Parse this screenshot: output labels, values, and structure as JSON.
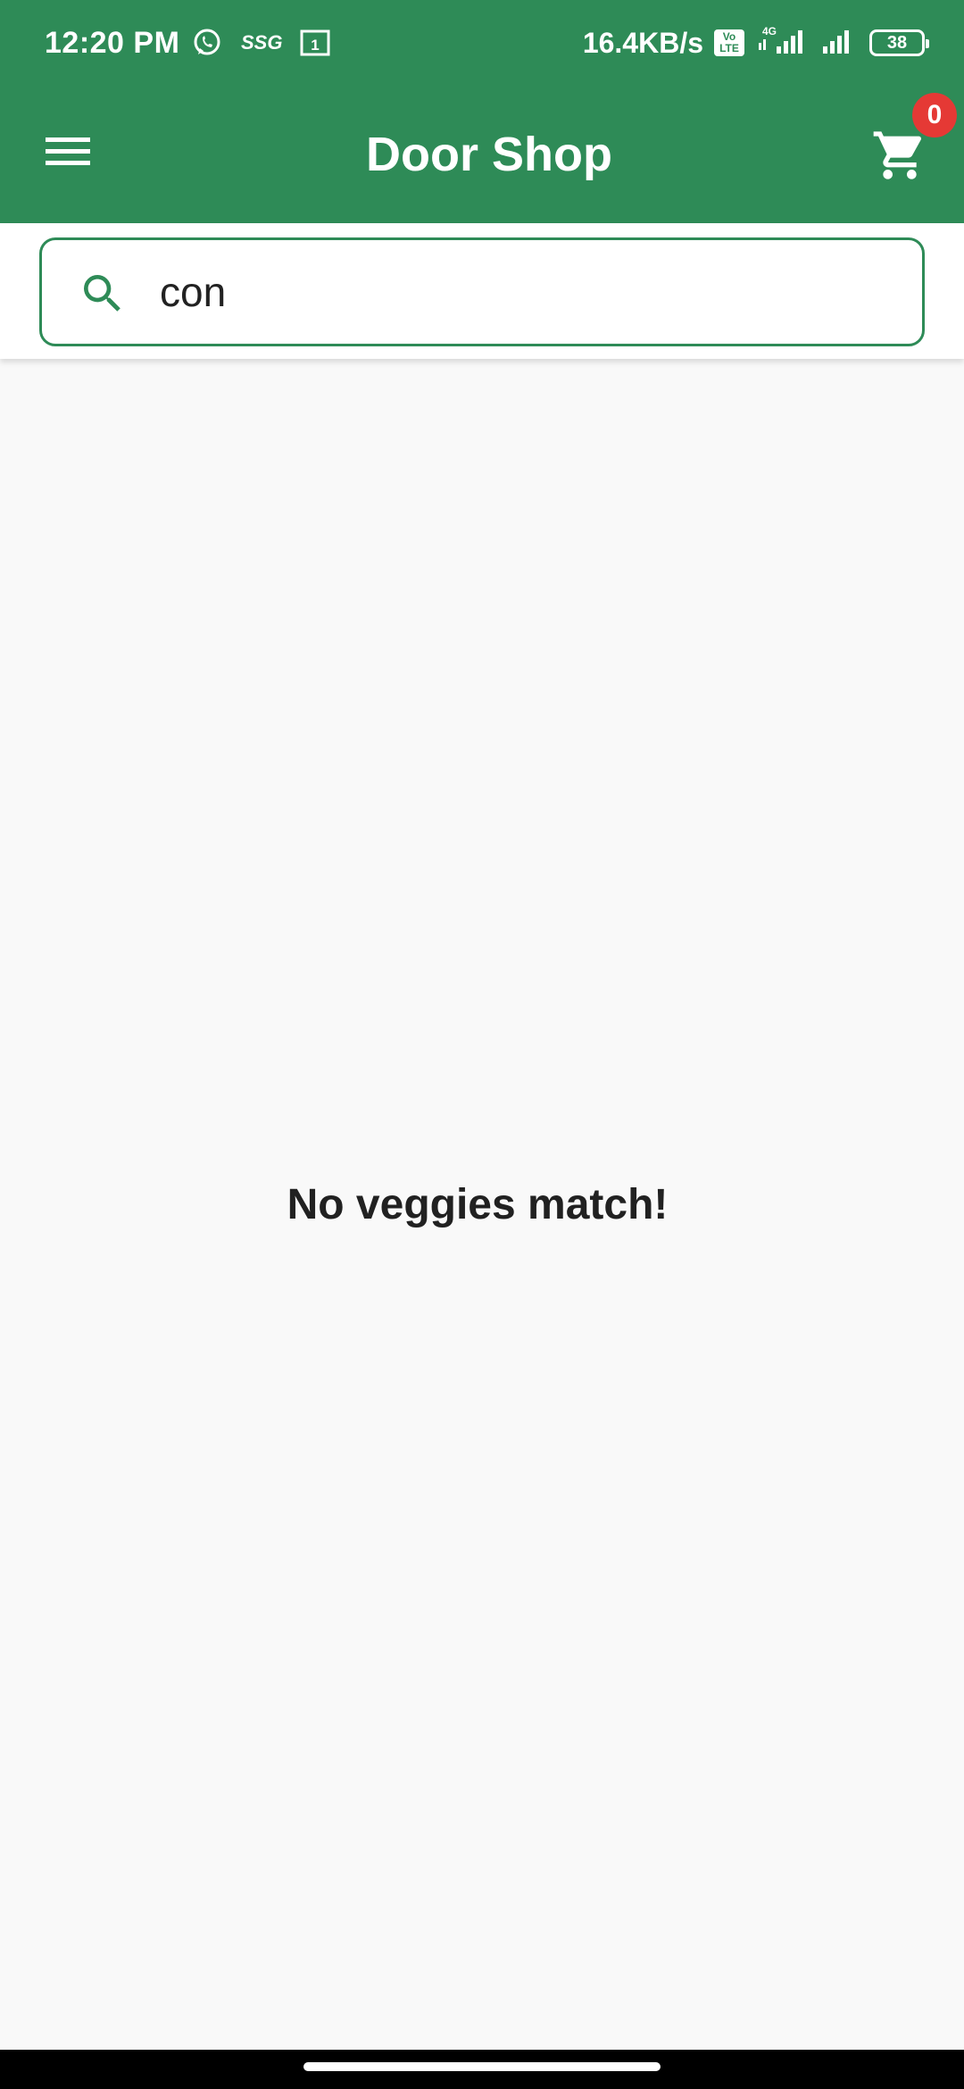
{
  "status_bar": {
    "time": "12:20 PM",
    "ssg_label": "SSG",
    "calendar_day": "1",
    "network_speed": "16.4KB/s",
    "volte_label": "Vo LTE",
    "network_type": "4G",
    "battery_level": "38",
    "icons": [
      "whatsapp-icon",
      "ssg-icon",
      "calendar-icon",
      "volte-icon",
      "signal-icon",
      "signal-icon",
      "battery-icon"
    ]
  },
  "app_bar": {
    "title": "Door Shop",
    "menu_icon": "menu-icon",
    "cart_icon": "cart-icon",
    "cart_count": "0"
  },
  "search": {
    "value": "con",
    "icon": "search-icon"
  },
  "content": {
    "empty_message": "No veggies match!"
  },
  "colors": {
    "primary": "#2e8b57",
    "badge": "#e53935",
    "background": "#f9f9f9",
    "text": "#212121"
  }
}
